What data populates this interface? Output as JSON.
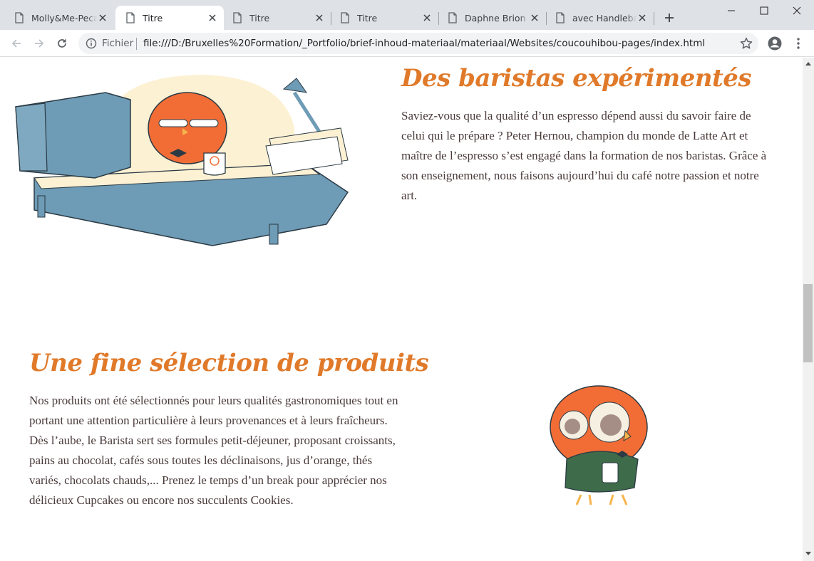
{
  "browser": {
    "tabs": [
      {
        "title": "Molly&Me-Pecan",
        "active": false
      },
      {
        "title": "Titre",
        "active": true
      },
      {
        "title": "Titre",
        "active": false
      },
      {
        "title": "Titre",
        "active": false
      },
      {
        "title": "Daphne Brion - I",
        "active": false
      },
      {
        "title": "avec Handlebars",
        "active": false
      }
    ],
    "address": {
      "scheme_label": "Fichier",
      "url": "file:///D:/Bruxelles%20Formation/_Portfolio/brief-inhoud-materiaal/materiaal/Websites/coucouhibou-pages/index.html"
    },
    "scroll_position": 0.45
  },
  "page": {
    "section1": {
      "title": "Des baristas expérimentés",
      "text": "Saviez-vous que la qualité d’un espresso dépend aussi du savoir faire de celui qui le prépare ? Peter Hernou, champion du monde de Latte Art et maître de l’espresso s’est engagé dans la formation de nos baristas. Grâce à son enseignement, nous faisons aujourd’hui du café notre passion et notre art.",
      "illustration": "owl-at-desk-illustration"
    },
    "section2": {
      "title": "Une fine sélection de produits",
      "text": "Nos produits ont été sélectionnés pour leurs qualités gastronomiques tout en portant une attention particulière à leurs provenances et à leurs fraîcheurs. Dès l’aube, le Barista sert ses formules petit-déjeuner, proposant croissants, pains au chocolat, cafés sous toutes les déclinaisons, jus d’orange, thés variés, chocolats chauds,... Prenez le temps d’un break pour apprécier nos délicieux Cupcakes ou encore nos succulents Cookies.",
      "illustration": "owl-with-cup-illustration"
    }
  },
  "colors": {
    "heading": "#e07a2a",
    "body_text": "#4a3a3a",
    "owl_orange": "#f26d36",
    "desk_blue": "#6e9bb5",
    "cream": "#fdf1d4"
  }
}
